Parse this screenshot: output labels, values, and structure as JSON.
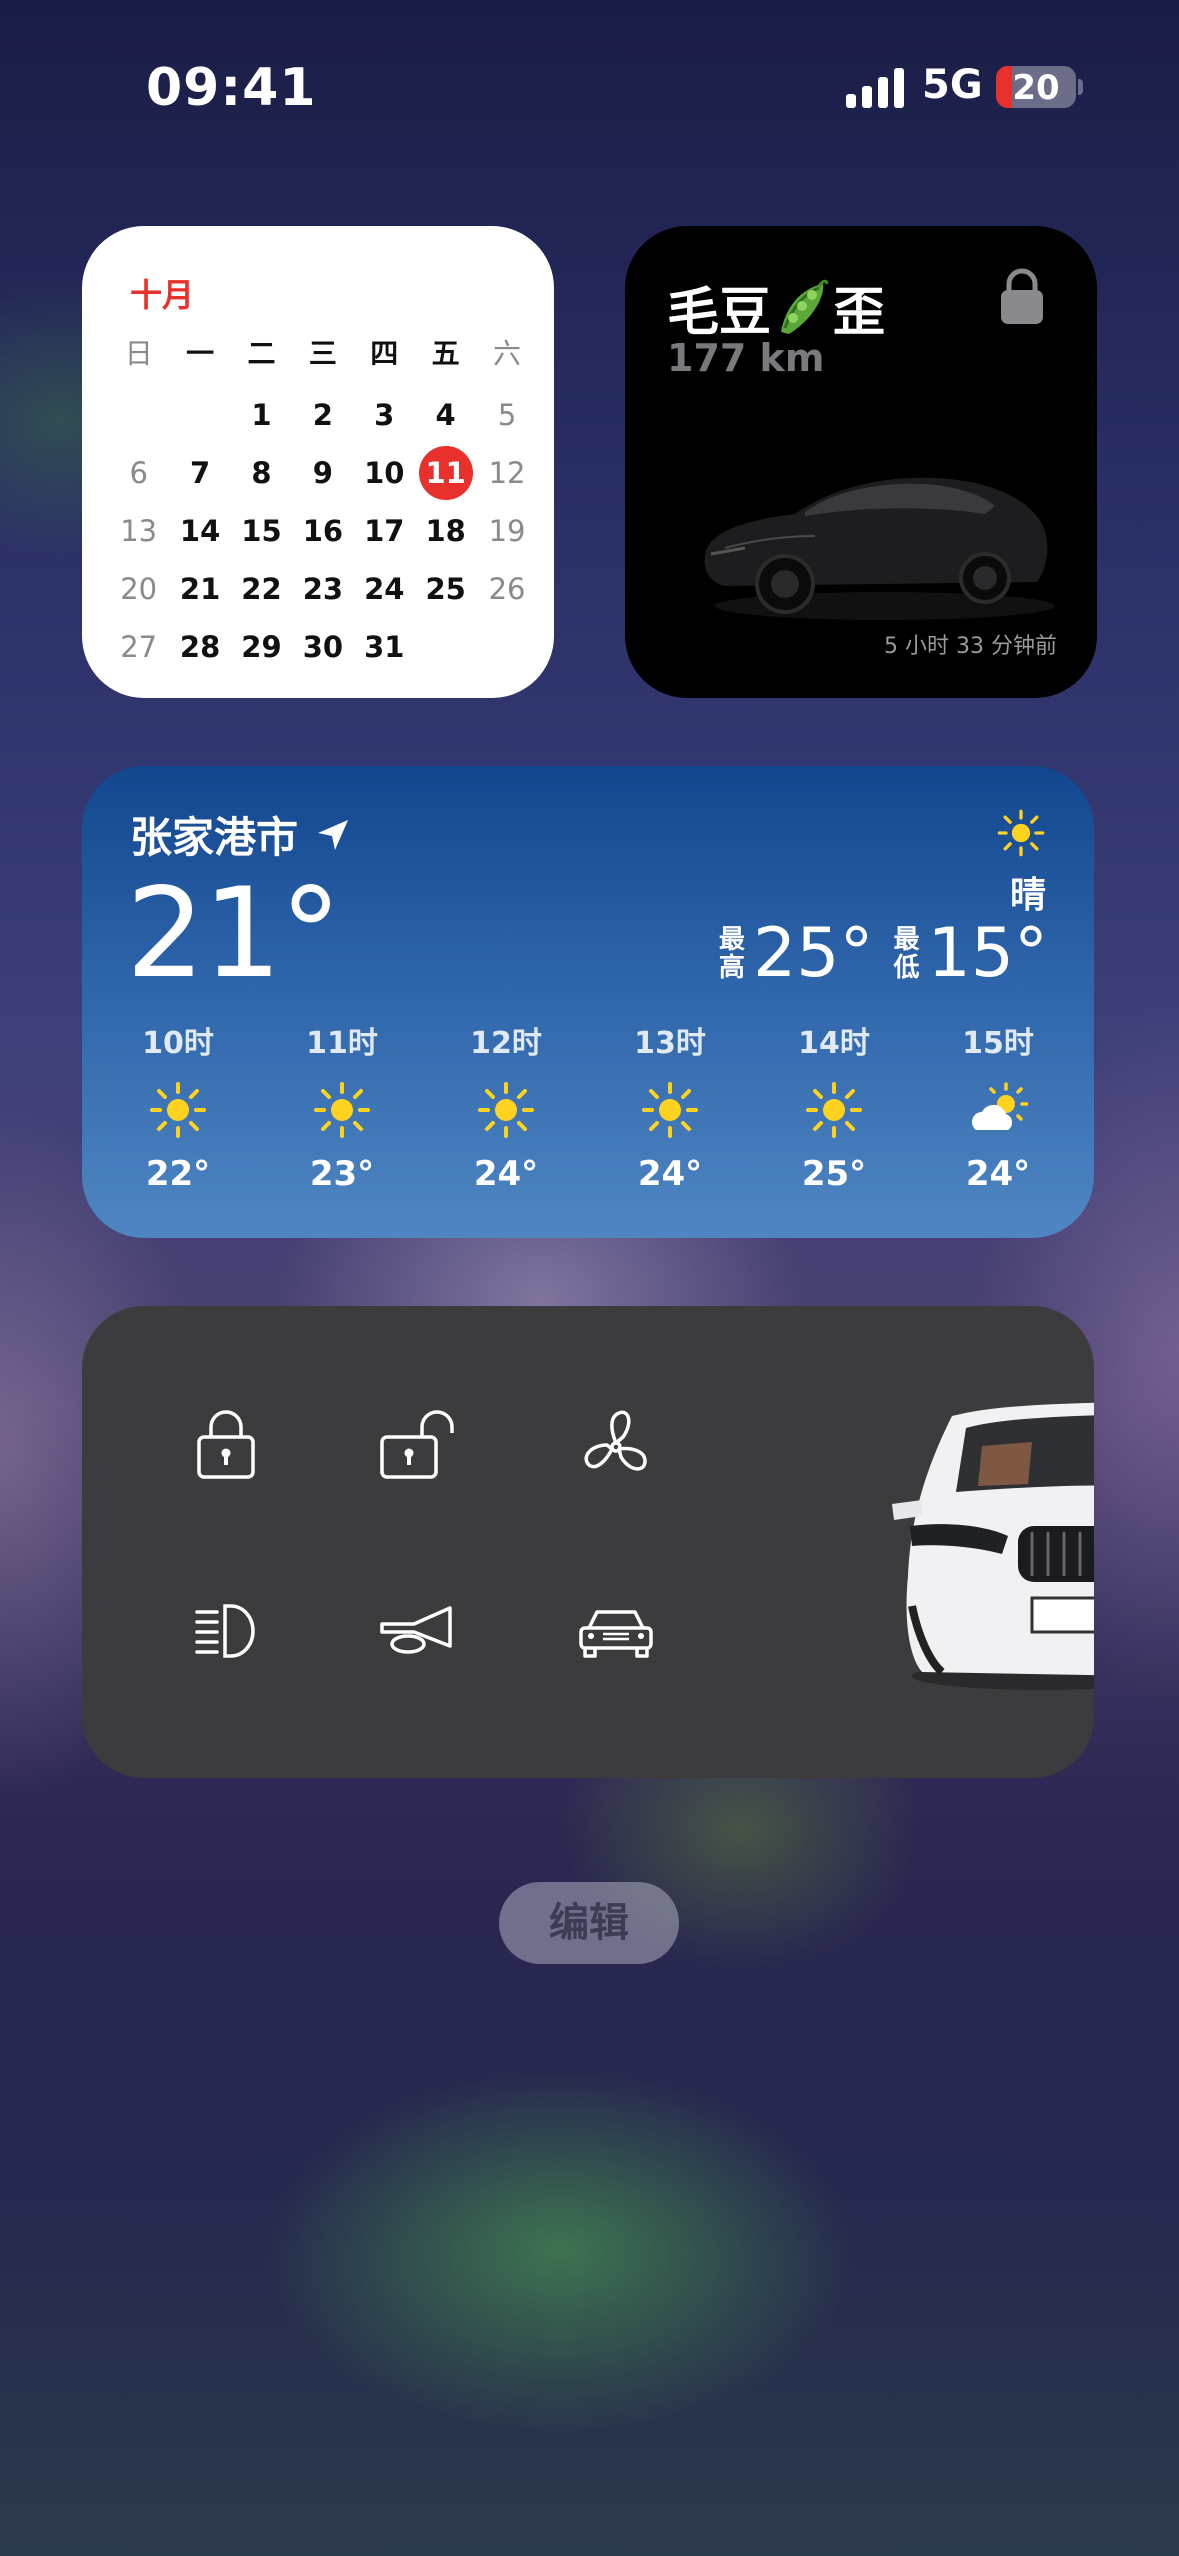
{
  "status_bar": {
    "time": "09:41",
    "network": "5G",
    "battery": "20",
    "battery_level": 0.2
  },
  "calendar": {
    "month": "十月",
    "weekdays": [
      "日",
      "一",
      "二",
      "三",
      "四",
      "五",
      "六"
    ],
    "weeks": [
      [
        "",
        "",
        "",
        "1",
        "2",
        "3",
        "4",
        "5"
      ],
      [
        "6",
        "7",
        "8",
        "9",
        "10",
        "11",
        "12"
      ],
      [
        "13",
        "14",
        "15",
        "16",
        "17",
        "18",
        "19"
      ],
      [
        "20",
        "21",
        "22",
        "23",
        "24",
        "25",
        "26"
      ],
      [
        "27",
        "28",
        "29",
        "30",
        "31",
        "",
        ""
      ]
    ],
    "today": "11"
  },
  "tesla": {
    "name_prefix": "毛豆",
    "name_suffix": "歪",
    "name_icon": "pea-pod-emoji",
    "range": "177 km",
    "lock_icon": "lock-icon",
    "updated": "5 小时 33 分钟前"
  },
  "weather": {
    "city": "张家港市",
    "location_icon": "location-arrow-icon",
    "temperature": "21°",
    "condition": "晴",
    "high_label": "最高",
    "high": "25°",
    "low_label": "最低",
    "low": "15°",
    "hourly": [
      {
        "hour": "10时",
        "icon": "sun-icon",
        "temp": "22°"
      },
      {
        "hour": "11时",
        "icon": "sun-icon",
        "temp": "23°"
      },
      {
        "hour": "12时",
        "icon": "sun-icon",
        "temp": "24°"
      },
      {
        "hour": "13时",
        "icon": "sun-icon",
        "temp": "24°"
      },
      {
        "hour": "14时",
        "icon": "sun-icon",
        "temp": "25°"
      },
      {
        "hour": "15时",
        "icon": "partly-cloudy-icon",
        "temp": "24°"
      }
    ]
  },
  "car_control": {
    "buttons": [
      "lock-icon",
      "unlock-icon",
      "fan-icon",
      "headlight-icon",
      "horn-icon",
      "car-icon"
    ]
  },
  "edit_button": "编辑"
}
